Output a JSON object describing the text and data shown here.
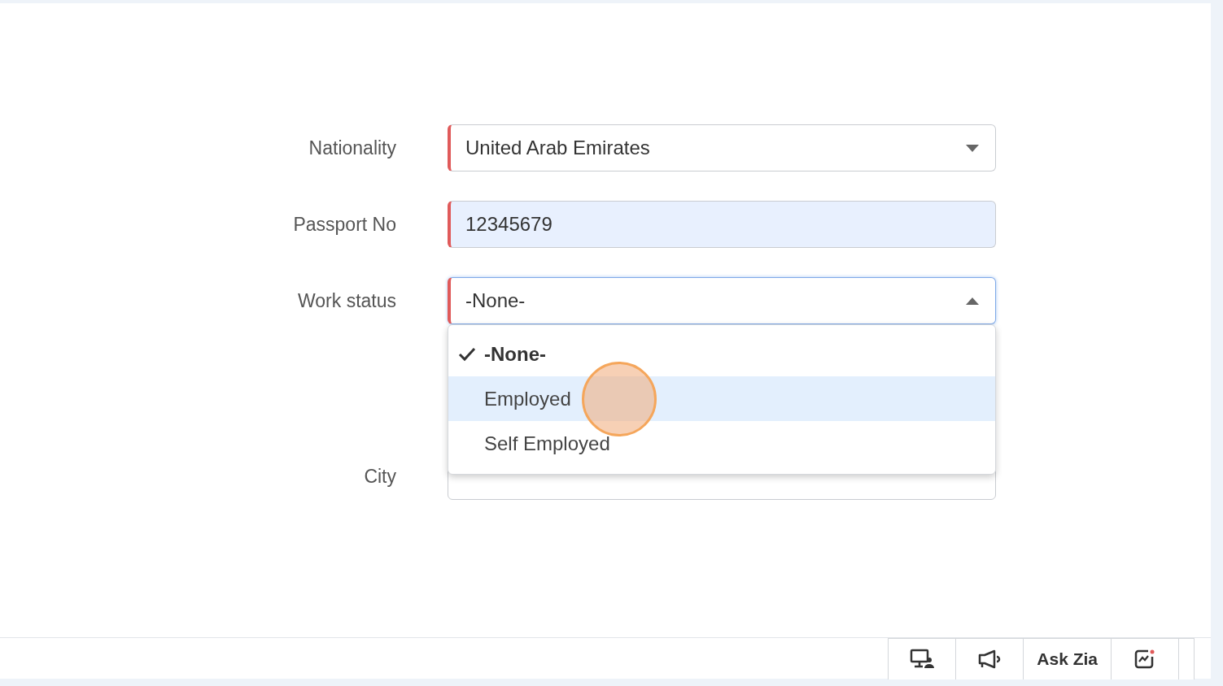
{
  "form": {
    "fields": [
      {
        "label": "Nationality",
        "kind": "select",
        "value": "United Arab Emirates",
        "required": true,
        "autofilled": false,
        "open": false
      },
      {
        "label": "Passport No",
        "kind": "text",
        "value": "12345679",
        "required": true,
        "autofilled": true,
        "open": false
      },
      {
        "label": "Work status",
        "kind": "select",
        "value": "-None-",
        "required": true,
        "autofilled": false,
        "open": true,
        "options": [
          {
            "label": "-None-",
            "selected": true,
            "highlighted": false
          },
          {
            "label": "Employed",
            "selected": false,
            "highlighted": true
          },
          {
            "label": "Self Employed",
            "selected": false,
            "highlighted": false
          }
        ]
      },
      {
        "label": "City",
        "kind": "text",
        "required": false,
        "autofilled": false,
        "open": false
      }
    ]
  },
  "bottom_bar": {
    "items": [
      {
        "kind": "icon"
      },
      {
        "kind": "icon"
      },
      {
        "kind": "text",
        "label": "Ask Zia"
      },
      {
        "kind": "icon"
      }
    ]
  }
}
